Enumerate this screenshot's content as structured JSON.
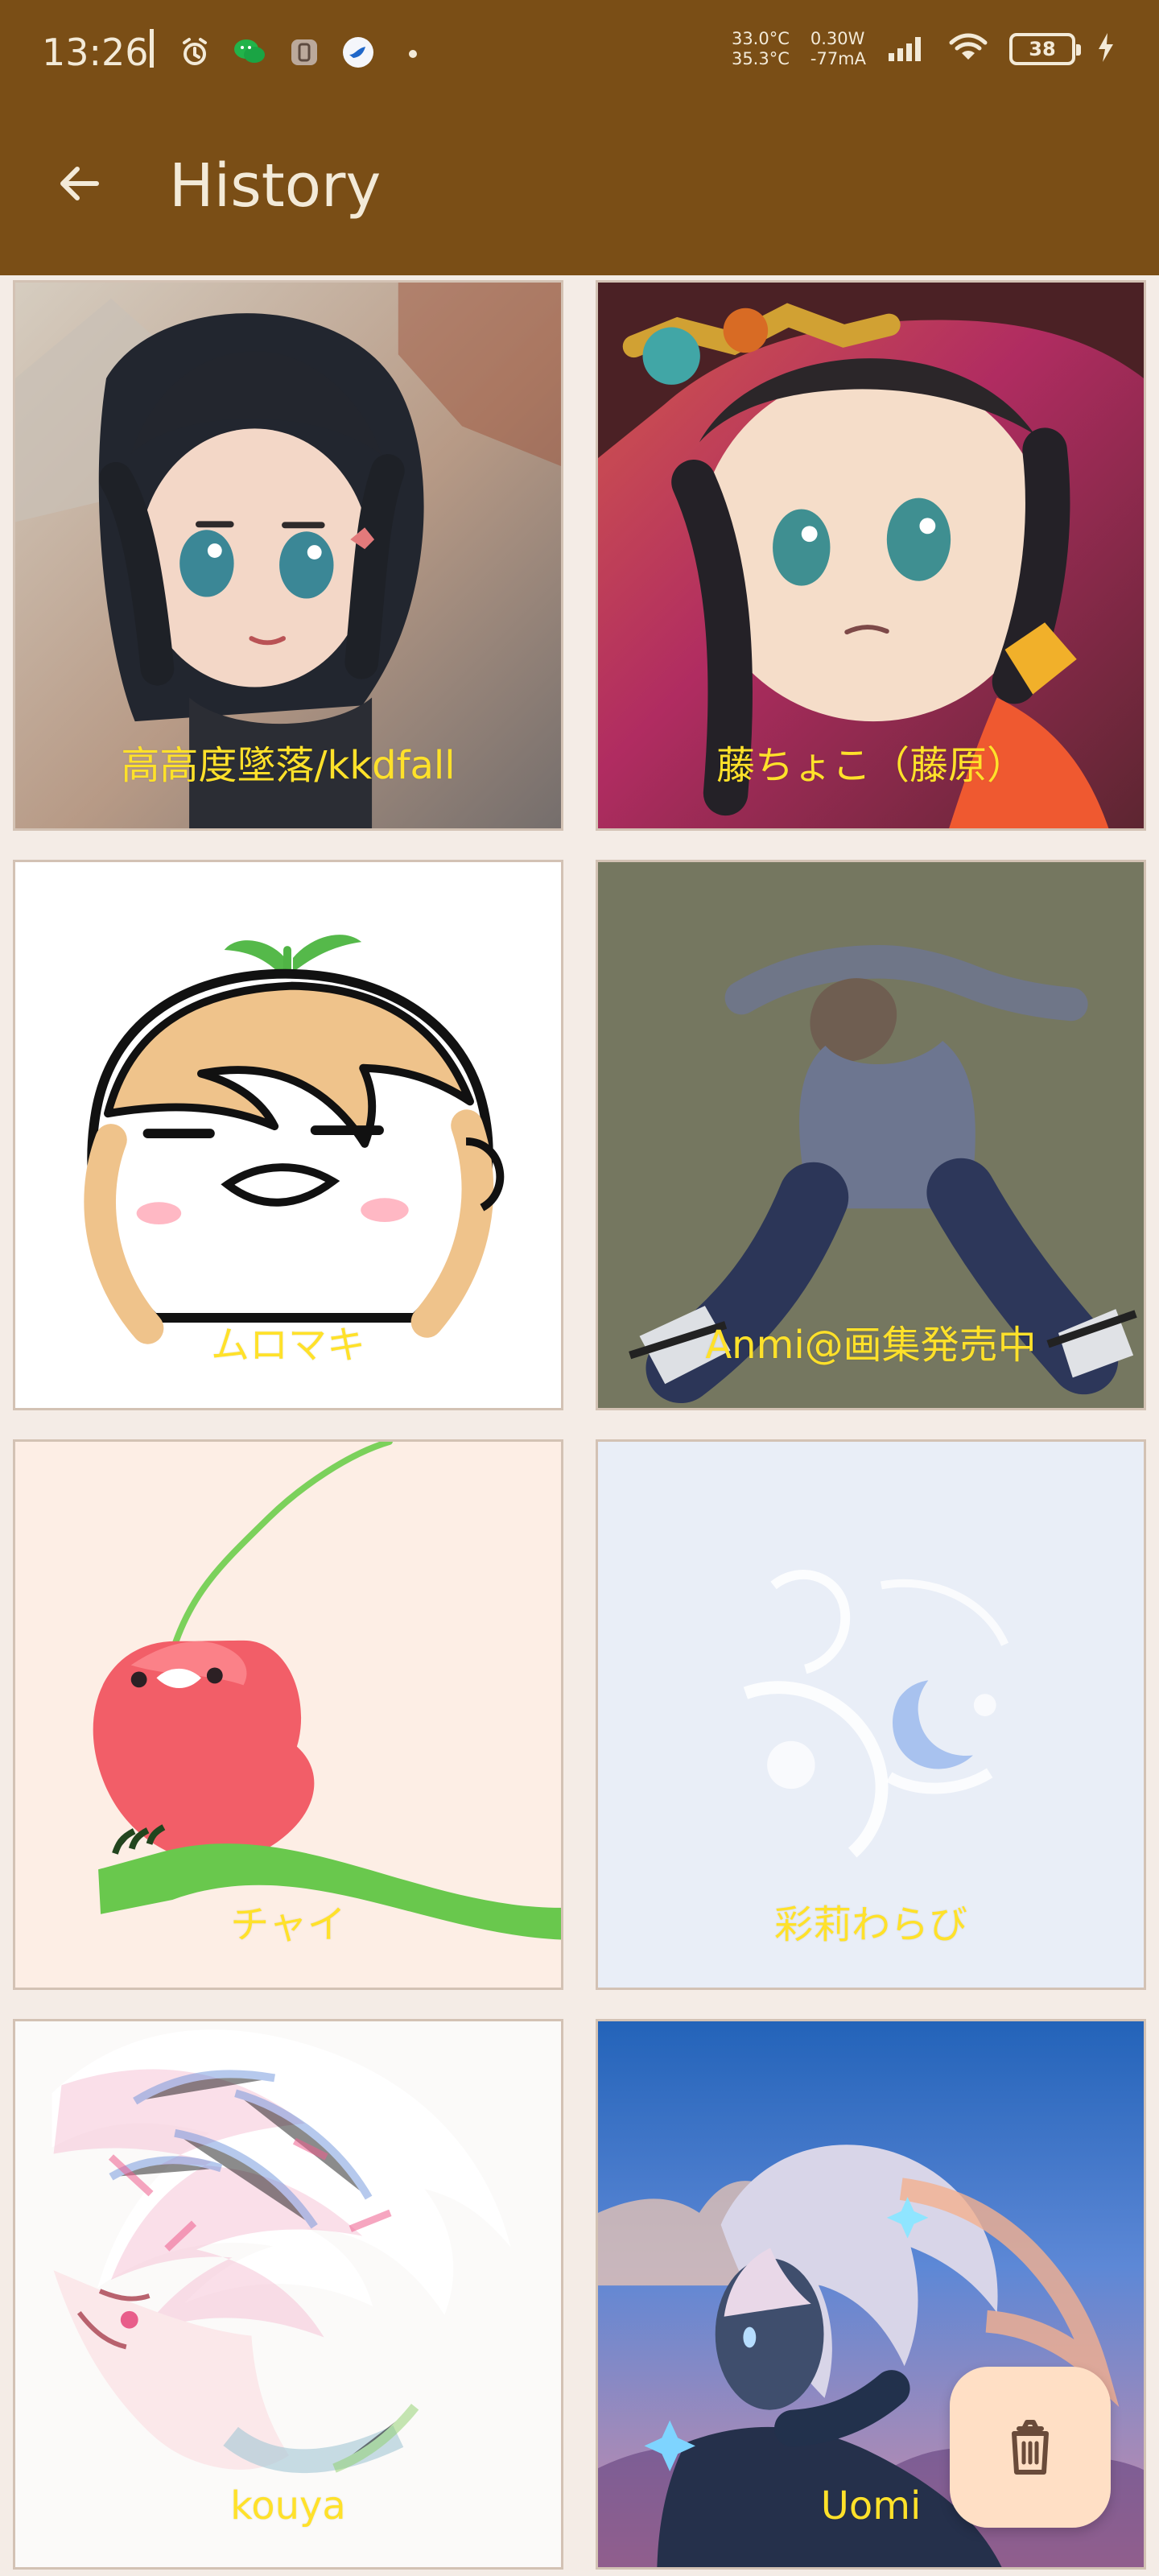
{
  "status_bar": {
    "time": "13:26",
    "temperature_top": "33.0°C",
    "temperature_bottom": "35.3°C",
    "power_top": "0.30W",
    "power_bottom": "-77mA",
    "battery_level": "38",
    "icons": [
      "alarm-icon",
      "chat-icon",
      "phone-manager-icon",
      "bird-app-icon",
      "dot-icon",
      "signal-icon",
      "wifi-icon",
      "charging-icon"
    ]
  },
  "app_bar": {
    "title": "History",
    "back_icon": "arrow-left-icon"
  },
  "history_items": [
    {
      "label": "高高度墜落/kkdfall"
    },
    {
      "label": "藤ちょこ（藤原）"
    },
    {
      "label": "ムロマキ"
    },
    {
      "label": "Anmi@画集発売中"
    },
    {
      "label": "チャイ"
    },
    {
      "label": "彩莉わらび"
    },
    {
      "label": "kouya"
    },
    {
      "label": "Uomi"
    }
  ],
  "fab": {
    "icon": "trash-icon"
  },
  "colors": {
    "app_bar": "#7a4e16",
    "page_background": "#f4ece6",
    "label_text": "#ffe12a",
    "fab_background": "#ffdfc5"
  }
}
